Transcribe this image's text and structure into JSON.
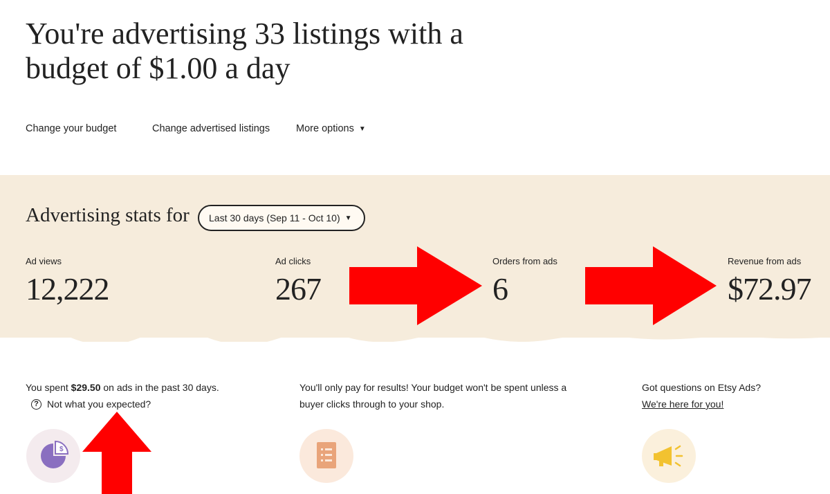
{
  "header": {
    "title": "You're advertising 33 listings with a budget of $1.00 a day"
  },
  "actions": {
    "change_budget": "Change your budget",
    "change_listings": "Change advertised listings",
    "more_options": "More options",
    "caret": "▼"
  },
  "stats": {
    "title": "Advertising stats for",
    "date_range": "Last 30 days (Sep 11 - Oct 10)",
    "caret": "▼",
    "items": [
      {
        "label": "Ad views",
        "value": "12,222"
      },
      {
        "label": "Ad clicks",
        "value": "267"
      },
      {
        "label": "Orders from ads",
        "value": "6"
      },
      {
        "label": "Revenue from ads",
        "value": "$72.97"
      }
    ]
  },
  "info": {
    "spent_prefix": "You spent",
    "spent_amount": "$29.50",
    "spent_suffix": "on ads in the past 30 days.",
    "help_glyph": "?",
    "not_expected": "Not what you expected?",
    "pay_results_line1": "You'll only pay for results! Your budget won't be spent unless a",
    "pay_results_line2": "buyer clicks through to your shop.",
    "questions": "Got questions on Etsy Ads?",
    "here_for_you": "We're here for you!"
  },
  "icons": {
    "pie": "pie-chart-dollar-icon",
    "document": "document-list-icon",
    "megaphone": "megaphone-icon"
  },
  "colors": {
    "band": "#f6ecdc",
    "annotation_arrow": "#ff0000",
    "pie_purple": "#8a6fc0",
    "doc_orange": "#e9a47a",
    "megaphone_yellow": "#f2c230"
  }
}
